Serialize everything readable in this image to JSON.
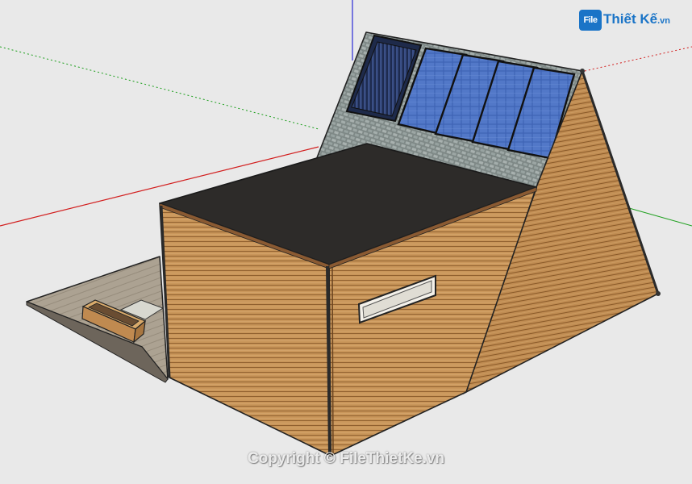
{
  "logo": {
    "box_text": "File",
    "main_text": "Thiết Kế",
    "suffix_text": ".vn"
  },
  "watermark": {
    "text": "Copyright © FileThietKe.vn"
  },
  "colors": {
    "background": "#e9e9e9",
    "wood": "#c9965a",
    "roof_flat": "#2d2b29",
    "shingles": "#8d9896",
    "solar_panel": "#3a5fb0",
    "axis_red": "#d21e1e",
    "axis_green": "#1fa01f",
    "axis_blue": "#2b2bd6"
  },
  "icons": [
    "solar-panel-icon",
    "window-icon",
    "planter-box-icon"
  ]
}
